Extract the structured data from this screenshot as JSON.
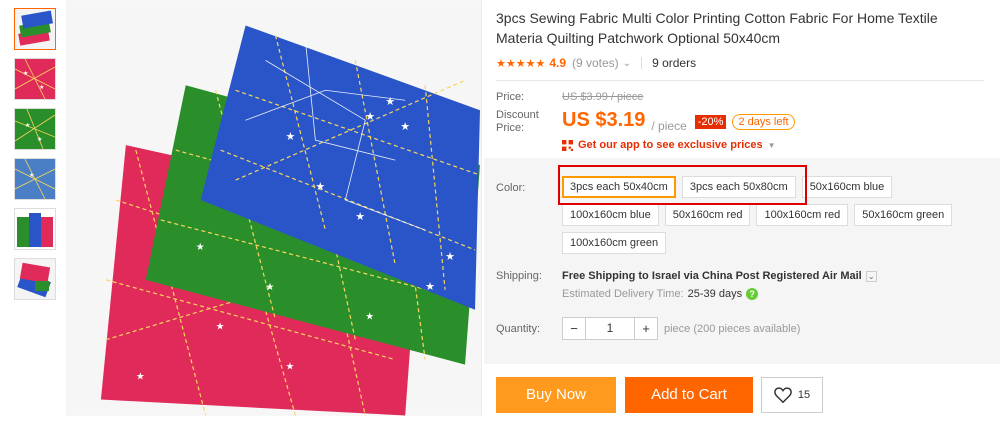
{
  "product": {
    "title": "3pcs Sewing Fabric Multi Color Printing Cotton Fabric For Home Textile Materia Quilting Patchwork Optional 50x40cm",
    "rating_stars": "★★★★★",
    "rating_value": "4.9",
    "votes": "(9 votes)",
    "orders": "9 orders"
  },
  "price": {
    "label": "Price:",
    "original": "US $3.99 / piece",
    "discount_label": "Discount Price:",
    "discount": "US $3.19",
    "per_piece": "/ piece",
    "percent_off": "-20%",
    "days_left": "2 days left",
    "app_promo": "Get our app to see exclusive prices"
  },
  "color": {
    "label": "Color:",
    "options": [
      "3pcs each 50x40cm",
      "3pcs each 50x80cm",
      "50x160cm blue",
      "100x160cm blue",
      "50x160cm red",
      "100x160cm red",
      "50x160cm green",
      "100x160cm green"
    ],
    "selected": "3pcs each 50x40cm"
  },
  "shipping": {
    "label": "Shipping:",
    "method": "Free Shipping to Israel via China Post Registered Air Mail",
    "estimate_label": "Estimated Delivery Time:",
    "estimate_days": "25-39 days"
  },
  "quantity": {
    "label": "Quantity:",
    "value": "1",
    "note": "piece (200 pieces available)",
    "minus": "−",
    "plus": "+"
  },
  "actions": {
    "buy_now": "Buy Now",
    "add_to_cart": "Add to Cart",
    "wishlist_count": "15"
  },
  "icons": {
    "heart": "heart-icon",
    "qr": "qr-code-icon",
    "help": "question-icon"
  },
  "colors": {
    "accent": "#ff6600",
    "buy_now": "#ff9a1e",
    "discount_tag": "#e62e04",
    "fabric_blue": "#2a55c8",
    "fabric_green": "#2a8f2a",
    "fabric_red": "#e02a5a"
  }
}
